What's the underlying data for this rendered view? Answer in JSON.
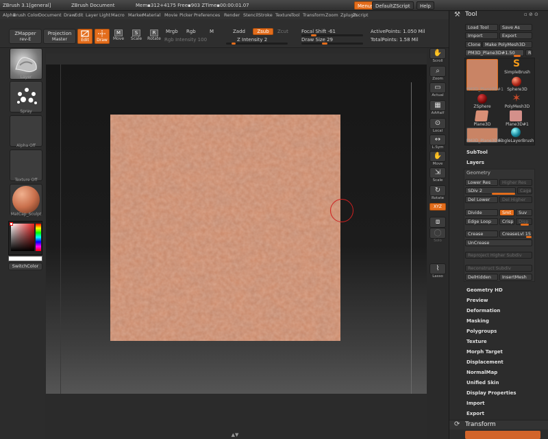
{
  "titlebar": {
    "app": "ZBrush  3.1[general]",
    "document": "ZBrush Document",
    "stats": "Mem▪312+4175  Free▪903  ZTime▪00:00:01.07",
    "menus_label": "Menus",
    "script_label": "DefaultZScript",
    "help_label": "Help"
  },
  "menubar": [
    "Alpha",
    "Brush",
    "Color",
    "Document",
    "Draw",
    "Edit",
    "Layer",
    "Light",
    "Macro",
    "Marker",
    "Material",
    "Movie",
    "Picker",
    "Preferences",
    "Render",
    "Stencil",
    "Stroke",
    "Texture",
    "Tool",
    "Transform",
    "Zoom",
    "Zplugin",
    "Zscript"
  ],
  "shelf": {
    "zmapper": "ZMapper",
    "zmapper_sub": "rev-E",
    "projection": "Projection",
    "projection_sub": "Master",
    "edit": "Edit",
    "draw": "Draw",
    "move": "Move",
    "scale": "Scale",
    "rotate": "Rotate",
    "mrgb": "Mrgb",
    "rgb": "Rgb",
    "m": "M",
    "rgb_intensity": "Rgb Intensity 100",
    "zadd": "Zadd",
    "zsub": "Zsub",
    "zcut": "Zcut",
    "z_intensity": "Z Intensity 2",
    "focal_shift": "Focal Shift -61",
    "draw_size": "Draw Size 29",
    "active_points": "ActivePoints: 1.050 Mil",
    "total_points": "TotalPoints: 1.58 Mil"
  },
  "lefttray": {
    "layer": "Layer",
    "spray": "Spray",
    "alpha_off": "Alpha Off",
    "texture_off": "Texture Off",
    "matcap": "MatCap_Sculpt",
    "switchcolor": "SwitchColor"
  },
  "righttray": [
    "Scroll",
    "Zoom",
    "Actual",
    "AAHalf",
    "Local",
    "L.Sym",
    "Move",
    "Scale",
    "Rotate",
    "XYZ",
    "Frame",
    "Solo",
    "Lasso"
  ],
  "tool": {
    "title": "Tool",
    "load_tool": "Load Tool",
    "save_as": "Save As",
    "import": "Import",
    "export": "Export",
    "clone": "Clone",
    "make_polymesh": "Make PolyMesh3D",
    "current_tool": "PM3D_Plane3D#1.50",
    "r": "R",
    "tools": [
      "PM3D_Plane3D#1",
      "SimpleBrush",
      "Sphere3D",
      "ZSphere",
      "PolyMesh3D",
      "Plane3D",
      "Plane3D#1",
      "PM3D_Plane3D#1",
      "SingleLayerBrush"
    ],
    "subtool": "SubTool",
    "layers": "Layers",
    "geometry": "Geometry",
    "lower_res": "Lower Res",
    "higher_res": "Higher Res",
    "sdiv": "SDiv 2",
    "cage": "Cage",
    "del_lower": "Del Lower",
    "del_higher": "Del Higher",
    "divide": "Divide",
    "smt": "Smt",
    "suv": "Suv",
    "edge_loop": "Edge Loop",
    "crisp": "Crisp",
    "disp": "Disp",
    "crease": "Crease",
    "creaselvl": "CreaseLvl 15",
    "uncrease": "UnCrease",
    "reproject": "Reproject Higher Subdiv",
    "reconstruct": "Reconstruct Subdiv",
    "delhidden": "DelHidden",
    "insertmesh": "InsertMesh",
    "sections": [
      "Geometry HD",
      "Preview",
      "Deformation",
      "Masking",
      "Polygroups",
      "Texture",
      "Morph Target",
      "Displacement",
      "NormalMap",
      "Unified Skin",
      "Display Properties",
      "Import",
      "Export"
    ],
    "transform": "Transform"
  },
  "colors": {
    "accent": "#e36d1c",
    "skin": "#c98465",
    "panel": "#2c2c2c"
  }
}
